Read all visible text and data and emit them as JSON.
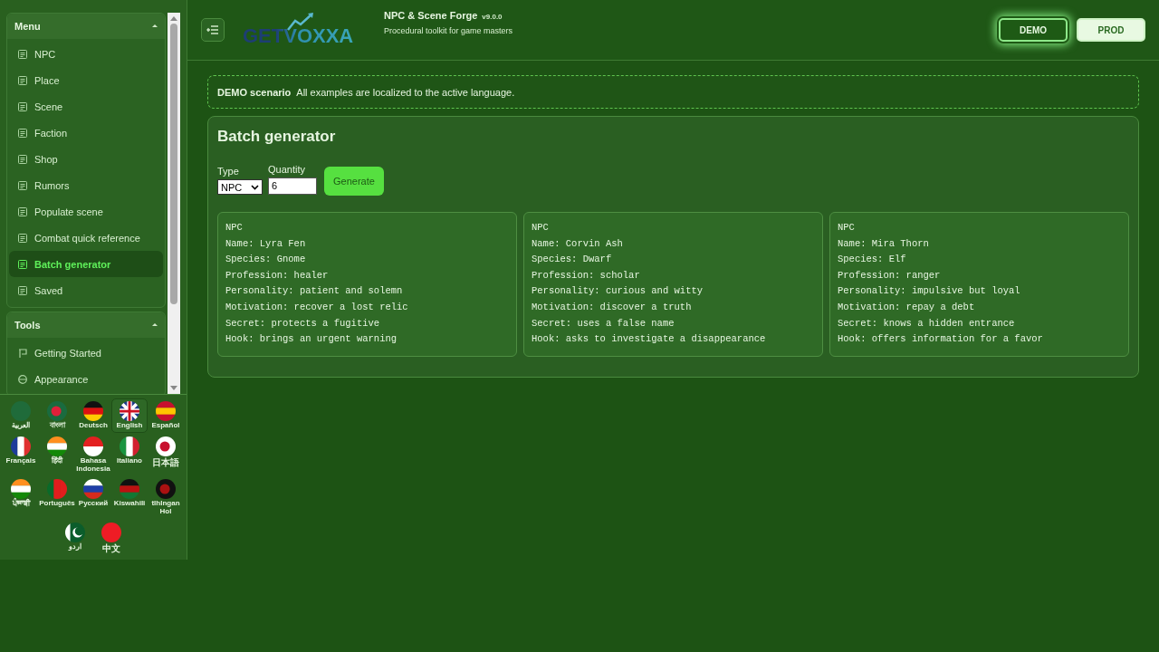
{
  "sidebar": {
    "sections": [
      {
        "title": "Menu",
        "expanded": true,
        "items": [
          {
            "label": "NPC",
            "selected": false
          },
          {
            "label": "Place",
            "selected": false
          },
          {
            "label": "Scene",
            "selected": false
          },
          {
            "label": "Faction",
            "selected": false
          },
          {
            "label": "Shop",
            "selected": false
          },
          {
            "label": "Rumors",
            "selected": false
          },
          {
            "label": "Populate scene",
            "selected": false
          },
          {
            "label": "Combat quick reference",
            "selected": false
          },
          {
            "label": "Batch generator",
            "selected": true
          },
          {
            "label": "Saved",
            "selected": false
          }
        ]
      },
      {
        "title": "Tools",
        "expanded": true,
        "items": [
          {
            "label": "Getting Started",
            "selected": false
          },
          {
            "label": "Appearance",
            "selected": false
          }
        ]
      }
    ],
    "languages": [
      {
        "label": "العربية",
        "selected": false
      },
      {
        "label": "বাংলা",
        "selected": false
      },
      {
        "label": "Deutsch",
        "selected": false
      },
      {
        "label": "English",
        "selected": true
      },
      {
        "label": "Español",
        "selected": false
      },
      {
        "label": "Français",
        "selected": false
      },
      {
        "label": "हिंदी",
        "selected": false
      },
      {
        "label": "Bahasa Indonesia",
        "selected": false
      },
      {
        "label": "Italiano",
        "selected": false
      },
      {
        "label": "日本語",
        "selected": false
      },
      {
        "label": "ਪੰਜਾਬੀ",
        "selected": false
      },
      {
        "label": "Português",
        "selected": false
      },
      {
        "label": "Русский",
        "selected": false
      },
      {
        "label": "Kiswahili",
        "selected": false
      },
      {
        "label": "tlhIngan Hol",
        "selected": false
      },
      {
        "label": "اردو",
        "selected": false
      },
      {
        "label": "中文",
        "selected": false
      }
    ]
  },
  "header": {
    "logo": "GETVOXXA",
    "title": "NPC & Scene Forge",
    "version": "v9.0.0",
    "subtitle": "Procedural toolkit for game masters",
    "modes": [
      {
        "label": "DEMO",
        "selected": true
      },
      {
        "label": "PROD",
        "selected": false
      }
    ]
  },
  "notice": {
    "label": "DEMO scenario",
    "text": "All examples are localized to the active language."
  },
  "panel": {
    "title": "Batch generator",
    "type_label": "Type",
    "type_value": "NPC",
    "quantity_label": "Quantity",
    "quantity_value": "6",
    "button": "Generate",
    "results": [
      {
        "lines": [
          "NPC",
          "Name: Lyra Fen",
          "Species: Gnome",
          "Profession: healer",
          "Personality: patient and solemn",
          "Motivation: recover a lost relic",
          "Secret: protects a fugitive",
          "Hook: brings an urgent warning"
        ]
      },
      {
        "lines": [
          "NPC",
          "Name: Corvin Ash",
          "Species: Dwarf",
          "Profession: scholar",
          "Personality: curious and witty",
          "Motivation: discover a truth",
          "Secret: uses a false name",
          "Hook: asks to investigate a disappearance"
        ]
      },
      {
        "lines": [
          "NPC",
          "Name: Mira Thorn",
          "Species: Elf",
          "Profession: ranger",
          "Personality: impulsive but loyal",
          "Motivation: repay a debt",
          "Secret: knows a hidden entrance",
          "Hook: offers information for a favor"
        ]
      }
    ]
  }
}
